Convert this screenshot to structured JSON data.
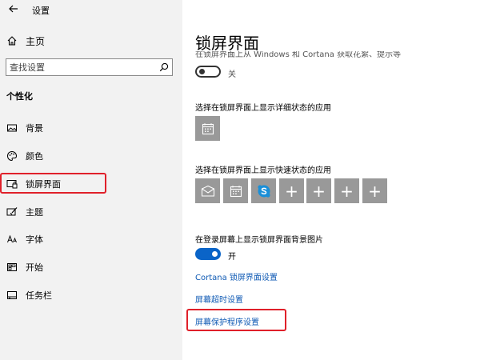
{
  "window": {
    "title": "设置"
  },
  "sidebar": {
    "home_label": "主页",
    "search_placeholder": "查找设置",
    "section_title": "个性化",
    "items": [
      {
        "label": "背景",
        "icon": "picture-icon"
      },
      {
        "label": "颜色",
        "icon": "palette-icon"
      },
      {
        "label": "锁屏界面",
        "icon": "lock-screen-icon",
        "active": true
      },
      {
        "label": "主题",
        "icon": "brush-icon"
      },
      {
        "label": "字体",
        "icon": "font-icon"
      },
      {
        "label": "开始",
        "icon": "start-icon"
      },
      {
        "label": "任务栏",
        "icon": "taskbar-icon"
      }
    ]
  },
  "main": {
    "title": "锁屏界面",
    "cut_desc": "在锁屏界面上从 Windows 和 Cortana 获取花絮、提示等",
    "tips_toggle": {
      "state": "off",
      "label": "关"
    },
    "detailed_status_label": "选择在锁屏界面上显示详细状态的应用",
    "quick_status_label": "选择在锁屏界面上显示快速状态的应用",
    "quick_tiles": [
      {
        "icon": "mail-icon"
      },
      {
        "icon": "calendar-icon"
      },
      {
        "icon": "skype-icon"
      },
      {
        "icon": "plus-icon",
        "text": "+"
      },
      {
        "icon": "plus-icon",
        "text": "+"
      },
      {
        "icon": "plus-icon",
        "text": "+"
      },
      {
        "icon": "plus-icon",
        "text": "+"
      }
    ],
    "signin_bg_label": "在登录屏幕上显示锁屏界面背景图片",
    "signin_toggle": {
      "state": "on",
      "label": "开"
    },
    "links": {
      "cortana": "Cortana 锁屏界面设置",
      "timeout": "屏幕超时设置",
      "screensaver": "屏幕保护程序设置"
    }
  },
  "colors": {
    "accent": "#0a64c8",
    "link": "#0f5ab4",
    "tile": "#999999",
    "highlight": "#e0202a",
    "sidebar_bg": "#f2f2f2"
  }
}
